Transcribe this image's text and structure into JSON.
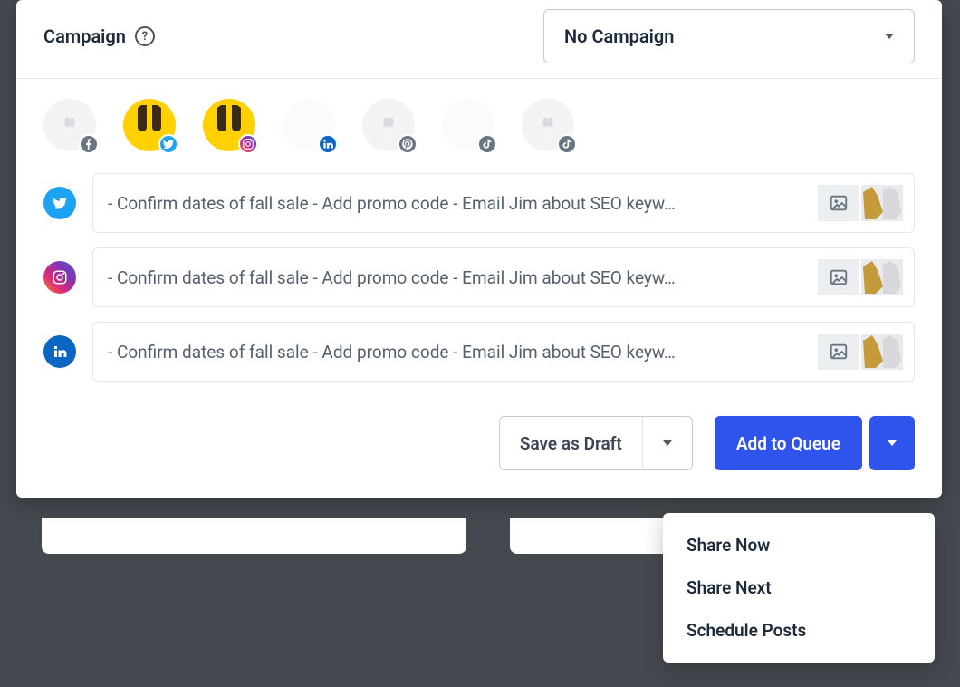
{
  "header": {
    "title": "Campaign",
    "select_label": "No Campaign"
  },
  "profiles": [
    {
      "badge": "facebook",
      "avatar": "light"
    },
    {
      "badge": "twitter",
      "avatar": "yellow"
    },
    {
      "badge": "instagram",
      "avatar": "yellow"
    },
    {
      "badge": "linkedin",
      "avatar": "blank"
    },
    {
      "badge": "pinterest",
      "avatar": "light"
    },
    {
      "badge": "tiktok",
      "avatar": "blank"
    },
    {
      "badge": "tiktok",
      "avatar": "light"
    }
  ],
  "rows": [
    {
      "network": "twitter",
      "text": "- Confirm dates of fall sale - Add promo code - Email Jim about SEO keyw…"
    },
    {
      "network": "instagram",
      "text": "- Confirm dates of fall sale - Add promo code - Email Jim about SEO keyw…"
    },
    {
      "network": "linkedin",
      "text": "- Confirm dates of fall sale - Add promo code - Email Jim about SEO keyw…"
    }
  ],
  "footer": {
    "save_draft_label": "Save as Draft",
    "add_to_queue_label": "Add to Queue"
  },
  "menu": {
    "items": [
      "Share Now",
      "Share Next",
      "Schedule Posts"
    ]
  },
  "colors": {
    "primary": "#2f54eb",
    "twitter": "#1da1f2",
    "linkedin": "#0a66c2"
  }
}
